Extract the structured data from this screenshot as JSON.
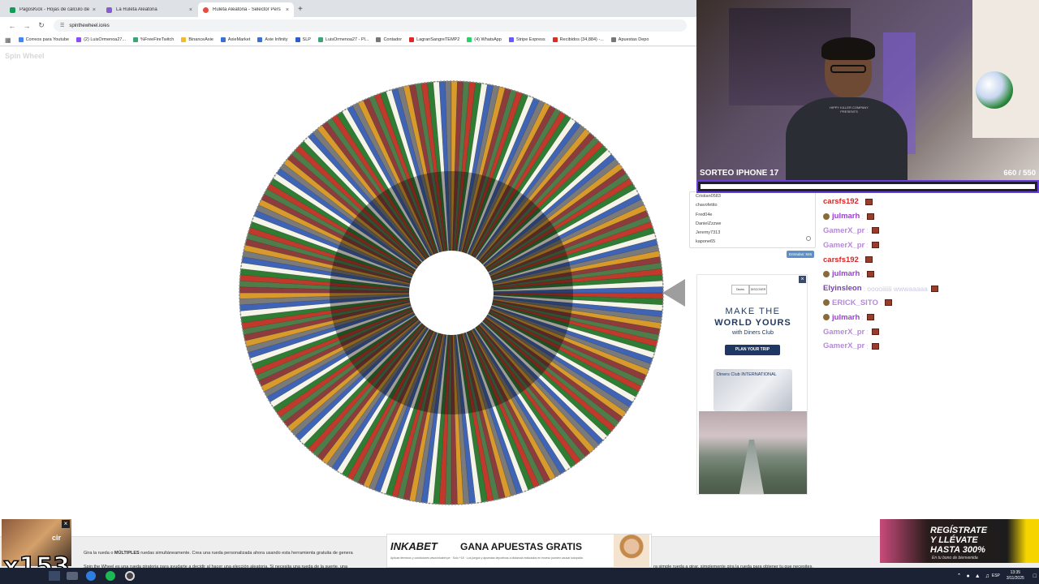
{
  "browser": {
    "tabs": [
      {
        "label": "PagosKick - Hojas de cálculo de",
        "active": false,
        "color": "#0f9d58"
      },
      {
        "label": "La Ruleta Aleatoria",
        "active": false,
        "color": "#8a5cd0"
      },
      {
        "label": "Ruleta Aleatoria - Selector Pers",
        "active": true,
        "color": "#e94b3c"
      }
    ],
    "new_tab": "+",
    "close_glyph": "×",
    "url": "spinthewheel.io/es",
    "bookmarks": [
      {
        "label": "Correos para Youtube",
        "color": "#4285f4"
      },
      {
        "label": "(2) LuisOrmenoa27...",
        "color": "#9146ff"
      },
      {
        "label": "%FreeFireTwitch",
        "color": "#3aa675"
      },
      {
        "label": "BinanceAxie",
        "color": "#f3ba2f"
      },
      {
        "label": "AxieMarket",
        "color": "#3a6fd8"
      },
      {
        "label": "Axie Infinity",
        "color": "#3a6fd8"
      },
      {
        "label": "SLP",
        "color": "#2c5bd6"
      },
      {
        "label": "LuisOrmenoa27 - Pl...",
        "color": "#3aa675"
      },
      {
        "label": "Contador",
        "color": "#777777"
      },
      {
        "label": "LagranSangreTEMP2",
        "color": "#e02828"
      },
      {
        "label": "(4) WhatsApp",
        "color": "#25d366"
      },
      {
        "label": "Stripe Express",
        "color": "#635bff"
      },
      {
        "label": "Recibidos (34,884) -...",
        "color": "#d93025"
      },
      {
        "label": "Apuestas Depo",
        "color": "#777777"
      }
    ]
  },
  "page": {
    "brand": "Spin Wheel",
    "wheel": {
      "segments": 220,
      "colors": [
        "#c0392b",
        "#2e7d32",
        "#f4f4e8",
        "#3f63b5",
        "#7a7a7a",
        "#d89a2a",
        "#8d3b3b",
        "#4f7d4a"
      ],
      "hub_color": "#ffffff",
      "pointer_color": "#9e9e9e"
    },
    "entries": [
      "Cristian0583",
      "chavofetito",
      "Fred04e",
      "DanielZzzwe",
      "Jeremy7313",
      "kapone65"
    ],
    "entries_badge": "Entradas: 846",
    "ad": {
      "close": "×",
      "logo_left": "Diners",
      "logo_right": "DISCOVER",
      "line1": "MAKE THE",
      "line2": "WORLD YOURS",
      "line3": "with Diners Club",
      "cta": "PLAN YOUR TRIP",
      "card_text": "Diners Club INTERNATIONAL"
    },
    "bottom_text": {
      "line1_pre": "Gira la rueda o ",
      "line1_bold": "MÚLTIPLES",
      "line1_post": " ruedas simultáneamente. Crea una rueda personalizada ahora usando esta herramienta gratuita de genera",
      "line2": "Spin the Wheel es una rueda giratoria para ayudarte a decidir al hacer una elección aleatoria. Si necesita una rueda de la suerte, una",
      "line2_right": "ra simple rueda a girar, simplemente gira la rueda para obtener tu que necesites."
    }
  },
  "stream": {
    "giveaway_title": "SORTEO IPHONE 17",
    "giveaway_count": "660 / 550",
    "progress": 1.0,
    "shirt_text": "HIPPY KILLER COMPANY PRESENTS",
    "chat": [
      {
        "user": "carsfs192",
        "color": "#d62828",
        "text": ":",
        "badge": false
      },
      {
        "user": "julmarh",
        "color": "#9a3fd0",
        "text": ":",
        "badge": true
      },
      {
        "user": "GamerX_pr",
        "color": "#b58ad8",
        "text": ":",
        "badge": false
      },
      {
        "user": "GamerX_pr",
        "color": "#b58ad8",
        "text": ":",
        "badge": false
      },
      {
        "user": "carsfs192",
        "color": "#d62828",
        "text": ":",
        "badge": false
      },
      {
        "user": "julmarh",
        "color": "#9a3fd0",
        "text": ":",
        "badge": true
      },
      {
        "user": "Elyinsleon",
        "color": "#7b3fbf",
        "text": ": ooooiiiiii wwwaaaaa",
        "badge": false
      },
      {
        "user": "ERICK_SITO",
        "color": "#b58ad8",
        "text": ":",
        "badge": true
      },
      {
        "user": "julmarh",
        "color": "#9a3fd0",
        "text": ":",
        "badge": true
      },
      {
        "user": "GamerX_pr",
        "color": "#b58ad8",
        "text": ":",
        "badge": false
      },
      {
        "user": "GamerX_pr",
        "color": "#b58ad8",
        "text": ":",
        "badge": false
      }
    ],
    "thumb_text": "cir",
    "combo": "x153",
    "inkabet": {
      "logo": "INKABET",
      "slogan": "GANA APUESTAS GRATIS",
      "fine": "Aplican términos y condiciones www.inkabet.pe · Solo +18 · Los juegos y apuestas deportivas a distancia realizados en exceso pueden causar ludopatía"
    },
    "promo": {
      "l1": "REGÍSTRATE",
      "l2": "Y LLÉVATE",
      "l3": "HASTA 300%",
      "l4": "En tu bono de bienvenida"
    }
  },
  "taskbar": {
    "lang": "ESP",
    "time": "13:35",
    "date": "3/11/2025"
  }
}
